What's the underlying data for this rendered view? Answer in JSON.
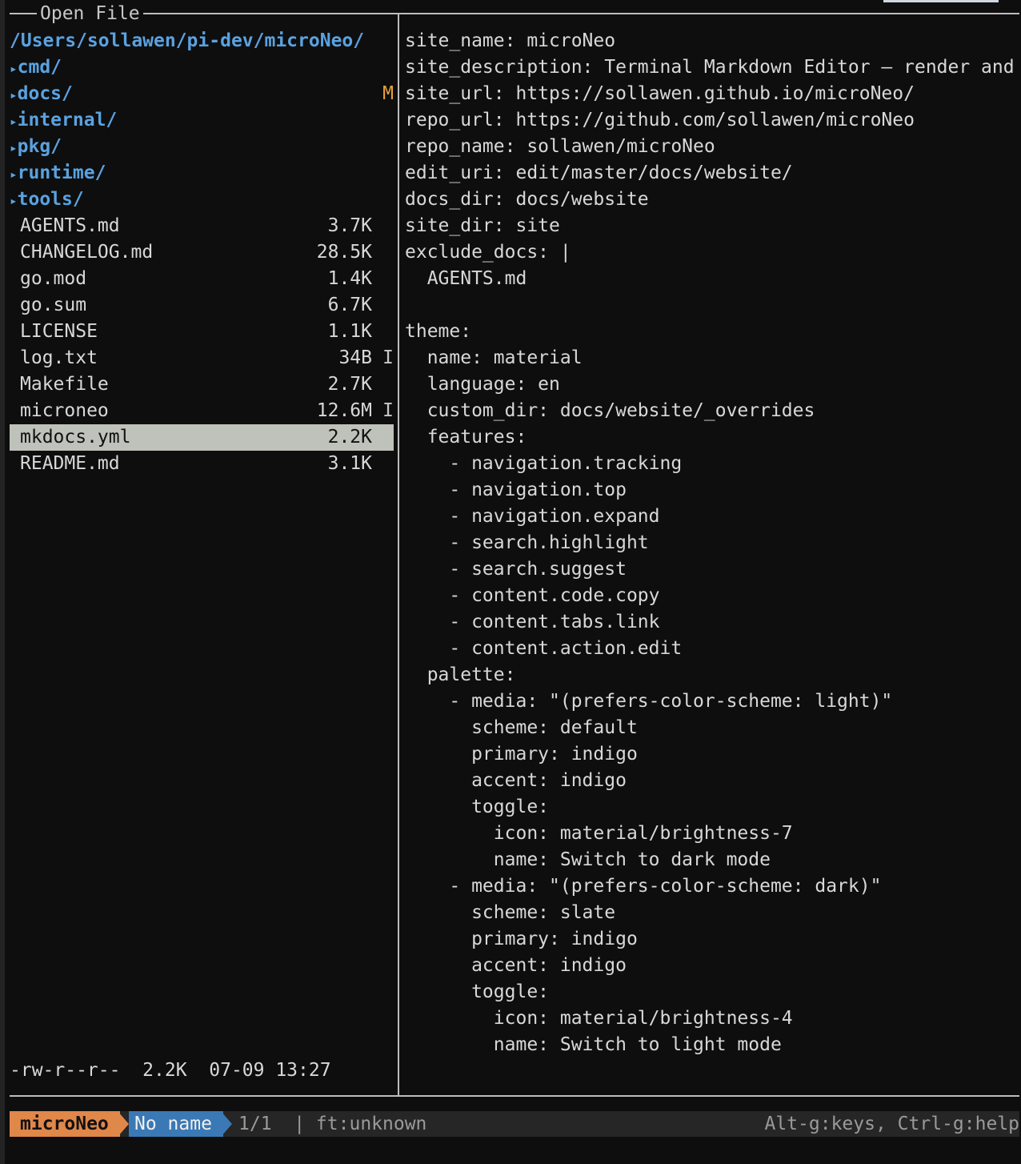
{
  "dialog": {
    "title": "Open File"
  },
  "browser": {
    "path": "/Users/sollawen/pi-dev/microNeo/",
    "directories": [
      {
        "name": "cmd/",
        "git": ""
      },
      {
        "name": "docs/",
        "git": "M"
      },
      {
        "name": "internal/",
        "git": ""
      },
      {
        "name": "pkg/",
        "git": ""
      },
      {
        "name": "runtime/",
        "git": ""
      },
      {
        "name": "tools/",
        "git": ""
      }
    ],
    "files": [
      {
        "name": "AGENTS.md",
        "size": "3.7K",
        "flag": ""
      },
      {
        "name": "CHANGELOG.md",
        "size": "28.5K",
        "flag": ""
      },
      {
        "name": "go.mod",
        "size": "1.4K",
        "flag": ""
      },
      {
        "name": "go.sum",
        "size": "6.7K",
        "flag": ""
      },
      {
        "name": "LICENSE",
        "size": "1.1K",
        "flag": ""
      },
      {
        "name": "log.txt",
        "size": "34B",
        "flag": "I"
      },
      {
        "name": "Makefile",
        "size": "2.7K",
        "flag": ""
      },
      {
        "name": "microneo",
        "size": "12.6M",
        "flag": "I"
      },
      {
        "name": "mkdocs.yml",
        "size": "2.2K",
        "flag": "",
        "selected": true
      },
      {
        "name": "README.md",
        "size": "3.1K",
        "flag": ""
      }
    ],
    "selected_info": "-rw-r--r--  2.2K  07-09 13:27",
    "arrow_glyph": "▸"
  },
  "preview": {
    "lines": [
      "site_name: microNeo",
      "site_description: Terminal Markdown Editor — render and edi",
      "site_url: https://sollawen.github.io/microNeo/",
      "repo_url: https://github.com/sollawen/microNeo",
      "repo_name: sollawen/microNeo",
      "edit_uri: edit/master/docs/website/",
      "docs_dir: docs/website",
      "site_dir: site",
      "exclude_docs: |",
      "  AGENTS.md",
      "",
      "theme:",
      "  name: material",
      "  language: en",
      "  custom_dir: docs/website/_overrides",
      "  features:",
      "    - navigation.tracking",
      "    - navigation.top",
      "    - navigation.expand",
      "    - search.highlight",
      "    - search.suggest",
      "    - content.code.copy",
      "    - content.tabs.link",
      "    - content.action.edit",
      "  palette:",
      "    - media: \"(prefers-color-scheme: light)\"",
      "      scheme: default",
      "      primary: indigo",
      "      accent: indigo",
      "      toggle:",
      "        icon: material/brightness-7",
      "        name: Switch to dark mode",
      "    - media: \"(prefers-color-scheme: dark)\"",
      "      scheme: slate",
      "      primary: indigo",
      "      accent: indigo",
      "      toggle:",
      "        icon: material/brightness-4",
      "        name: Switch to light mode"
    ]
  },
  "statusbar": {
    "brand": "microNeo",
    "buffer_name": "No name",
    "position": "1/1  | ft:unknown",
    "help": "Alt-g:keys, Ctrl-g:help"
  },
  "colors": {
    "background": "#0e0e0e",
    "directory": "#5aa2e0",
    "git_modified": "#e5a23b",
    "selection": "#bfc1bb",
    "brand": "#e0874a",
    "buffer": "#3a79b5"
  }
}
